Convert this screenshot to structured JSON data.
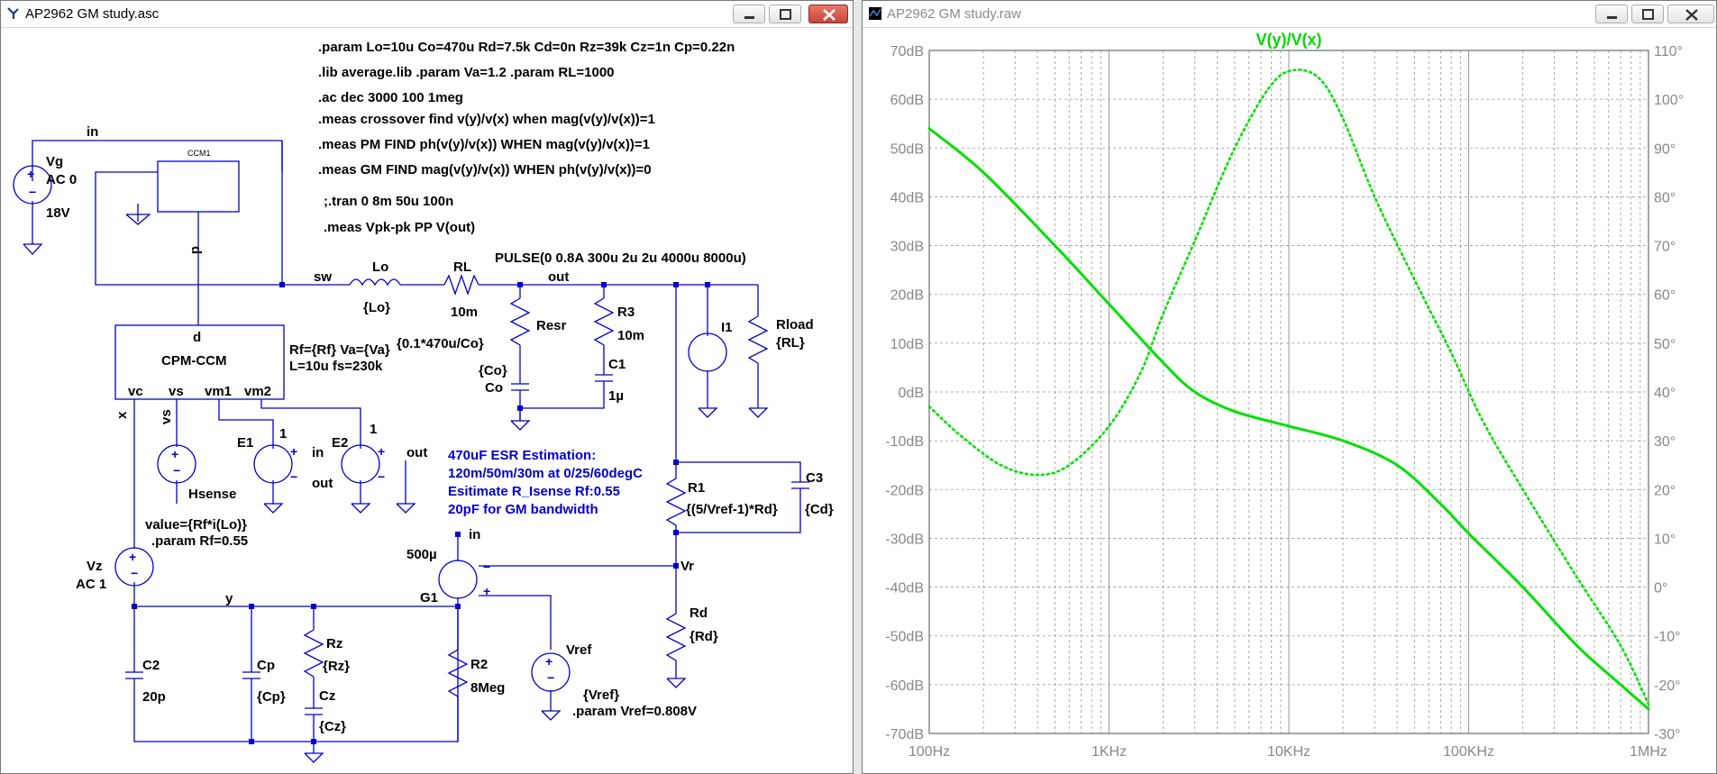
{
  "left_window": {
    "title": "AP2962 GM study.asc",
    "directives": [
      ".param Lo=10u Co=470u Rd=7.5k Cd=0n Rz=39k Cz=1n Cp=0.22n",
      ".lib average.lib   .param Va=1.2   .param RL=1000",
      ".ac dec 3000 100 1meg",
      ".meas crossover find v(y)/v(x) when mag(v(y)/v(x))=1",
      ".meas PM FIND ph(v(y)/v(x)) WHEN mag(v(y)/v(x))=1",
      ".meas GM FIND mag(v(y)/v(x)) WHEN ph(v(y)/v(x))=0",
      ";.tran 0 8m 50u 100n",
      ".meas Vpk-pk PP V(out)"
    ],
    "comment_lines": [
      "470uF ESR Estimation:",
      "120m/50m/30m at 0/25/60degC",
      "Esitimate R_Isense Rf:0.55",
      "20pF for GM bandwidth"
    ],
    "labels": {
      "in": "in",
      "vg_name": "Vg",
      "vg_ac": "AC 0",
      "vg_dc": "18V",
      "ccm1": "CCM1",
      "d_net": "d",
      "d_pin": "d",
      "sw": "sw",
      "lo_name": "Lo",
      "lo_val": "{Lo}",
      "rl_name": "RL",
      "rl_val": "10m",
      "pulse": "PULSE(0 0.8A 300u 2u 2u 4000u 8000u)",
      "out": "out",
      "resr": "Resr",
      "resr_val": "{0.1*470u/Co}",
      "co_val": "{Co}",
      "co_name": "Co",
      "r3": "R3",
      "r3_val": "10m",
      "c1": "C1",
      "c1_val": "1µ",
      "i1": "I1",
      "rload": "Rload",
      "rload_val": "{RL}",
      "cpm": "CPM-CCM",
      "vc": "vc",
      "vs": "vs",
      "vm1": "vm1",
      "vm2": "vm2",
      "cpm_param1": "Rf={Rf} Va={Va}",
      "cpm_param2": "L=10u fs=230k",
      "x": "x",
      "vs_net": "vs",
      "e1": "E1",
      "e1_gain": "1",
      "e2": "E2",
      "e2_gain": "1",
      "pin_in": "in",
      "pin_out": "out",
      "pin_out2": "out",
      "hsense": "Hsense",
      "hsense_val": "value={Rf*i(Lo)}",
      "param_rf": ".param Rf=0.55",
      "vz": "Vz",
      "vz_ac": "AC 1",
      "y": "y",
      "c3": "C3",
      "c3_val": "{Cd}",
      "r1": "R1",
      "r1_val": "{(5/Vref-1)*Rd}",
      "vr": "Vr",
      "g1": "G1",
      "g1_val": "500µ",
      "g1_in": "in",
      "rd": "Rd",
      "rd_val": "{Rd}",
      "c2": "C2",
      "c2_val": "20p",
      "cp": "Cp",
      "cp_val": "{Cp}",
      "rz": "Rz",
      "rz_val": "{Rz}",
      "cz": "Cz",
      "cz_val": "{Cz}",
      "r2": "R2",
      "r2_val": "8Meg",
      "vref": "Vref",
      "vref_val": "{Vref}",
      "vref_param": ".param Vref=0.808V"
    }
  },
  "right_window": {
    "title": "AP2962 GM study.raw"
  },
  "chart_data": {
    "type": "line",
    "title": "V(y)/V(x)",
    "x_scale": "log",
    "xlim": [
      100,
      1000000
    ],
    "x_ticks": [
      "100Hz",
      "1KHz",
      "10KHz",
      "100KHz",
      "1MHz"
    ],
    "y_left_ticks": [
      "70dB",
      "60dB",
      "50dB",
      "40dB",
      "30dB",
      "20dB",
      "10dB",
      "0dB",
      "-10dB",
      "-20dB",
      "-30dB",
      "-40dB",
      "-50dB",
      "-60dB",
      "-70dB"
    ],
    "y_right_ticks": [
      "110°",
      "100°",
      "90°",
      "80°",
      "70°",
      "60°",
      "50°",
      "40°",
      "30°",
      "20°",
      "10°",
      "0°",
      "-10°",
      "-20°",
      "-30°"
    ],
    "ylim_left": [
      -70,
      70
    ],
    "ylim_right": [
      -30,
      110
    ],
    "grid": true,
    "color": "#00e000",
    "series": [
      {
        "axis": "left",
        "style": "solid",
        "points": [
          [
            100,
            54
          ],
          [
            200,
            45
          ],
          [
            500,
            30
          ],
          [
            1000,
            18
          ],
          [
            2000,
            6
          ],
          [
            3000,
            0
          ],
          [
            5000,
            -4
          ],
          [
            10000,
            -7
          ],
          [
            20000,
            -10
          ],
          [
            40000,
            -15
          ],
          [
            70000,
            -23
          ],
          [
            100000,
            -29
          ],
          [
            200000,
            -40
          ],
          [
            400000,
            -52
          ],
          [
            700000,
            -60
          ],
          [
            1000000,
            -65
          ]
        ]
      },
      {
        "axis": "right",
        "style": "dotted",
        "points": [
          [
            100,
            37
          ],
          [
            150,
            31
          ],
          [
            250,
            25
          ],
          [
            400,
            23
          ],
          [
            600,
            25
          ],
          [
            1000,
            33
          ],
          [
            1500,
            44
          ],
          [
            2000,
            56
          ],
          [
            3000,
            71
          ],
          [
            5000,
            90
          ],
          [
            8000,
            103
          ],
          [
            11000,
            106
          ],
          [
            15000,
            104
          ],
          [
            20000,
            96
          ],
          [
            30000,
            80
          ],
          [
            50000,
            63
          ],
          [
            80000,
            48
          ],
          [
            120000,
            34
          ],
          [
            200000,
            20
          ],
          [
            400000,
            2
          ],
          [
            700000,
            -12
          ],
          [
            1000000,
            -24
          ]
        ]
      }
    ]
  }
}
